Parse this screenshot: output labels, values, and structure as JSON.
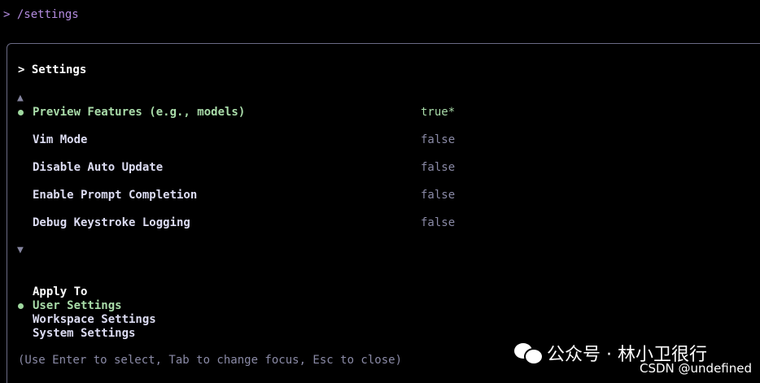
{
  "prompt": {
    "marker": ">",
    "command": "/settings"
  },
  "dialog": {
    "title": "> Settings",
    "scroll_up": "▲",
    "scroll_down": "▼",
    "rows": [
      {
        "label": "Preview Features (e.g., models)",
        "value": "true*",
        "selected": true
      },
      {
        "label": "Vim Mode",
        "value": "false",
        "selected": false
      },
      {
        "label": "Disable Auto Update",
        "value": "false",
        "selected": false
      },
      {
        "label": "Enable Prompt Completion",
        "value": "false",
        "selected": false
      },
      {
        "label": "Debug Keystroke Logging",
        "value": "false",
        "selected": false
      }
    ],
    "apply_to": {
      "title": "Apply To",
      "options": [
        "User Settings",
        "Workspace Settings",
        "System Settings"
      ],
      "selected": "User Settings"
    },
    "help": "(Use Enter to select, Tab to change focus, Esc to close)"
  },
  "watermark": {
    "text": "公众号 · 林小卫很行",
    "source": "CSDN @undefined"
  },
  "colors": {
    "background": "#000000",
    "accent_green": "#a9dca9",
    "prompt_purple": "#b48ce0",
    "muted": "#8a8aa6",
    "border": "#6b6b86"
  }
}
